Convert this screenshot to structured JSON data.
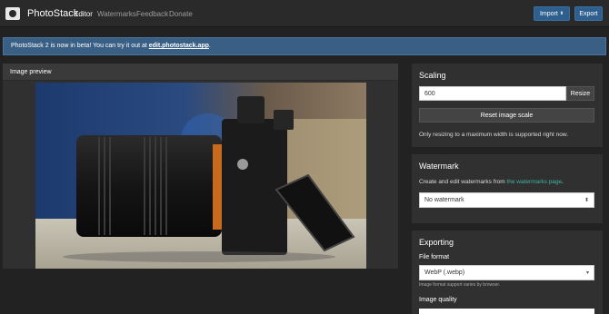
{
  "app": {
    "name": "PhotoStack"
  },
  "nav": {
    "editor": "Editor",
    "watermarks": "Watermarks",
    "feedback": "Feedback",
    "donate": "Donate"
  },
  "toolbar": {
    "import_label": "Import",
    "export_label": "Export"
  },
  "banner": {
    "text": "PhotoStack 2 is now in beta! You can try it out at ",
    "link": "edit.photostack.app",
    "suffix": "."
  },
  "preview": {
    "title": "Image preview"
  },
  "scaling": {
    "title": "Scaling",
    "width_value": "600",
    "resize_label": "Resize",
    "reset_label": "Reset image scale",
    "help": "Only resizing to a maximum width is supported right now."
  },
  "watermark": {
    "title": "Watermark",
    "help_prefix": "Create and edit watermarks from ",
    "help_link": "the watermarks page",
    "help_suffix": ".",
    "selected": "No watermark"
  },
  "exporting": {
    "title": "Exporting",
    "format_label": "File format",
    "format_selected": "WebP (.webp)",
    "format_help": "Image format support varies by browser.",
    "quality_label": "Image quality"
  },
  "colors": {
    "accent": "#2e5f8e",
    "banner": "#3a5f84",
    "link": "#3fb5a4",
    "background": "#222222",
    "panel": "#303030"
  }
}
